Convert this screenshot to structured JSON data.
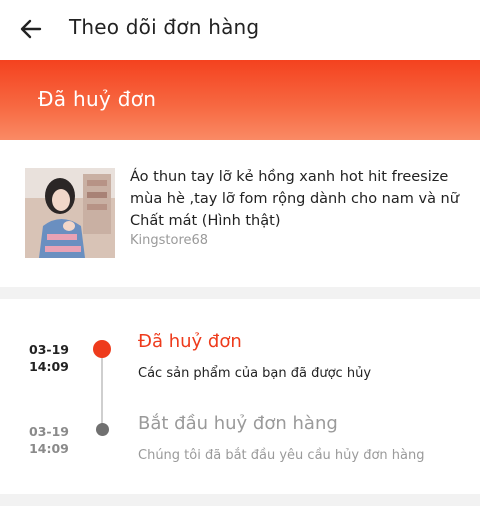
{
  "header": {
    "back_icon": "arrow-left-icon",
    "title": "Theo dõi đơn hàng"
  },
  "status_banner": {
    "text": "Đã huỷ đơn",
    "color": "#f4421f"
  },
  "product": {
    "name": "Áo thun tay lỡ kẻ hồng xanh hot hit freesize mùa hè ,tay lỡ fom rộng dành cho nam và nữ Chất mát (Hình thật)",
    "shop": "Kingstore68"
  },
  "timeline": {
    "active_color": "#ee3b1c",
    "events": [
      {
        "date": "03-19",
        "time": "14:09",
        "title": "Đã huỷ đơn",
        "description": "Các sản phẩm của bạn đã được hủy"
      },
      {
        "date": "03-19",
        "time": "14:09",
        "title": "Bắt đầu huỷ đơn hàng",
        "description": "Chúng tôi đã bắt đầu yêu cầu hủy đơn hàng"
      }
    ]
  }
}
